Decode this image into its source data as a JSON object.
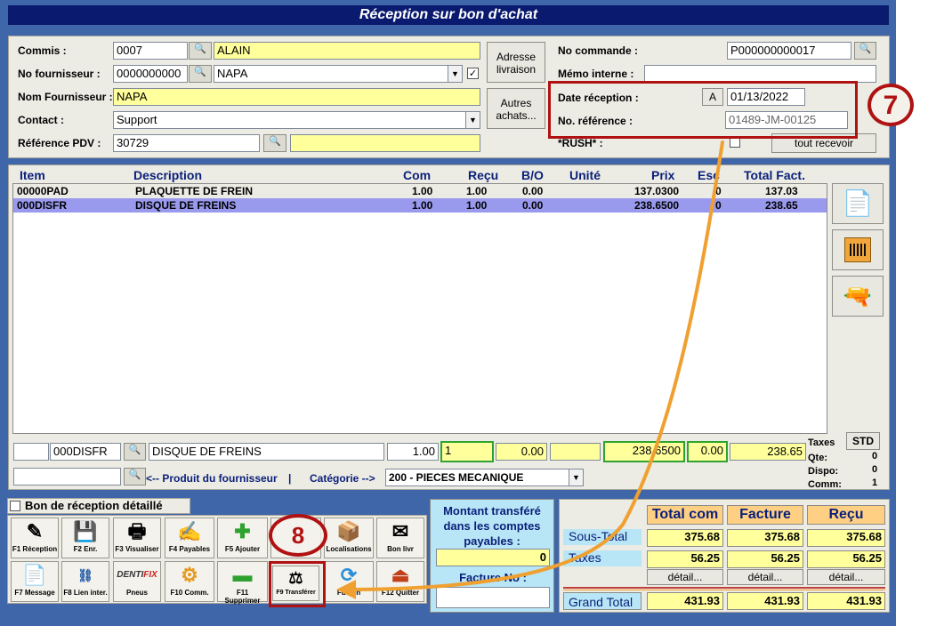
{
  "window": {
    "title": "Réception sur bon d'achat"
  },
  "header": {
    "commis_label": "Commis :",
    "commis_code": "0007",
    "commis_name": "ALAIN",
    "fournisseur_label": "No fournisseur :",
    "fournisseur_no": "0000000000",
    "fournisseur_name": "NAPA",
    "nom_fournisseur_label": "Nom Fournisseur :",
    "nom_fournisseur": "NAPA",
    "contact_label": "Contact :",
    "contact": "Support",
    "pdv_label": "Référence PDV :",
    "pdv": "30729",
    "adresse_btn": "Adresse livraison",
    "autres_btn": "Autres achats...",
    "no_commande_label": "No commande :",
    "no_commande": "P000000000017",
    "memo_label": "Mémo interne :",
    "date_reception_label": "Date réception :",
    "date_reception_btn": "A",
    "date_reception": "01/13/2022",
    "no_reference_label": "No. référence :",
    "no_reference": "01489-JM-00125",
    "rush_label": "*RUSH* :",
    "tout_recevoir": "tout recevoir"
  },
  "callouts": {
    "seven": "7",
    "eight": "8"
  },
  "grid": {
    "columns": [
      "Item",
      "Description",
      "Com",
      "Reçu",
      "B/O",
      "Unité",
      "Prix",
      "Esc",
      "Total Fact."
    ],
    "rows": [
      {
        "item": "00000PAD",
        "desc": "PLAQUETTE DE FREIN",
        "com": "1.00",
        "recu": "1.00",
        "bo": "0.00",
        "prix": "137.0300",
        "esc": "0",
        "total": "137.03"
      },
      {
        "item": "000DISFR",
        "desc": "DISQUE DE FREINS",
        "com": "1.00",
        "recu": "1.00",
        "bo": "0.00",
        "prix": "238.6500",
        "esc": "0",
        "total": "238.65"
      }
    ]
  },
  "edit_line": {
    "item": "000DISFR",
    "desc": "DISQUE DE FREINS",
    "com": "1.00",
    "recu": "1",
    "bo": "0.00",
    "prix": "238.6500",
    "esc": "0.00",
    "total": "238.65",
    "produit_label": "<-- Produit du fournisseur",
    "separator": "|",
    "categorie_label": "Catégorie -->",
    "categorie": "200 - PIECES MECANIQUE"
  },
  "stock": {
    "taxes_label": "Taxes",
    "std_btn": "STD",
    "qte_label": "Qte:",
    "qte": "0",
    "dispo_label": "Dispo:",
    "dispo": "0",
    "comm_label": "Comm:",
    "comm": "1"
  },
  "bon_detail_label": "Bon de réception détaillé",
  "toolbar": [
    {
      "label": "F1 Réception",
      "icon": "✎"
    },
    {
      "label": "F2 Enr.",
      "icon": "💾"
    },
    {
      "label": "F3 Visualiser",
      "icon": "🖶"
    },
    {
      "label": "F4 Payables",
      "icon": "✍"
    },
    {
      "label": "F5 Ajouter",
      "icon": "✚"
    },
    {
      "label": "",
      "icon": ""
    },
    {
      "label": "Localisations",
      "icon": "📦"
    },
    {
      "label": "Bon livr",
      "icon": "✉"
    },
    {
      "label": "F7 Message",
      "icon": "📄"
    },
    {
      "label": "F8 Lien inter.",
      "icon": "⛓"
    },
    {
      "label": "Pneus",
      "icon": ""
    },
    {
      "label": "F10 Comm.",
      "icon": "⚙"
    },
    {
      "label": "F11 Supprimer",
      "icon": "▬"
    },
    {
      "label": "F9 Transférer",
      "icon": "⚖"
    },
    {
      "label": "Fusion",
      "icon": "⟳"
    },
    {
      "label": "F12 Quitter",
      "icon": "⏏"
    }
  ],
  "montant": {
    "label": "Montant transféré dans les comptes payables :",
    "value": "0",
    "facture_label": "Facture No :"
  },
  "totals": {
    "headers": [
      "Total com",
      "Facture",
      "Reçu"
    ],
    "sous_total_label": "Sous-Total",
    "sous_total": [
      "375.68",
      "375.68",
      "375.68"
    ],
    "taxes_label": "Taxes",
    "taxes": [
      "56.25",
      "56.25",
      "56.25"
    ],
    "detail_btn": "détail...",
    "grand_total_label": "Grand Total",
    "grand_total": [
      "431.93",
      "431.93",
      "431.93"
    ]
  },
  "colors": {
    "frame": "#3f66a8",
    "title": "#0a1a6e",
    "yellow": "#ffff9c",
    "selected_row": "#9999ee",
    "callout_red": "#b01212",
    "arrow_orange": "#f0a030"
  }
}
